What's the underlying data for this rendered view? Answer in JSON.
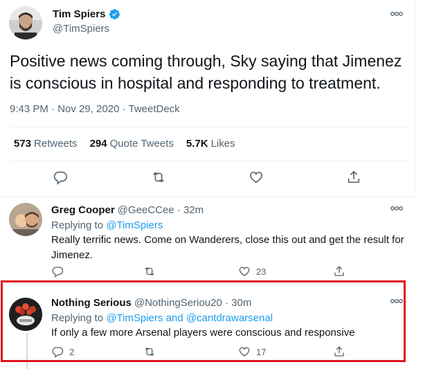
{
  "main_tweet": {
    "author": {
      "name": "Tim Spiers",
      "handle": "@TimSpiers"
    },
    "text": "Positive news coming through, Sky saying that Jimenez is conscious in hospital and responding to treatment.",
    "meta": "9:43 PM · Nov 29, 2020 · TweetDeck",
    "stats": {
      "retweets_count": "573",
      "retweets_label": "Retweets",
      "quotes_count": "294",
      "quotes_label": "Quote Tweets",
      "likes_count": "5.7K",
      "likes_label": "Likes"
    }
  },
  "replies": [
    {
      "name": "Greg Cooper",
      "handle_time": "@GeeCCee · 32m",
      "replying_prefix": "Replying to",
      "replying_to": "@TimSpiers",
      "text": "Really terrific news. Come on Wanderers, close this out and get the result for Jimenez.",
      "reply_count": "",
      "retweet_count": "",
      "like_count": "23"
    },
    {
      "name": "Nothing Serious",
      "handle_time": "@NothingSeriou20 · 30m",
      "replying_prefix": "Replying to",
      "replying_to": "@TimSpiers and @cantdrawarsenal",
      "text": "If only a few more Arsenal players were conscious and responsive",
      "reply_count": "2",
      "retweet_count": "",
      "like_count": "17"
    }
  ],
  "colors": {
    "accent": "#1d9bf0",
    "secondary_text": "#536471",
    "highlight_border": "#e0141e"
  }
}
